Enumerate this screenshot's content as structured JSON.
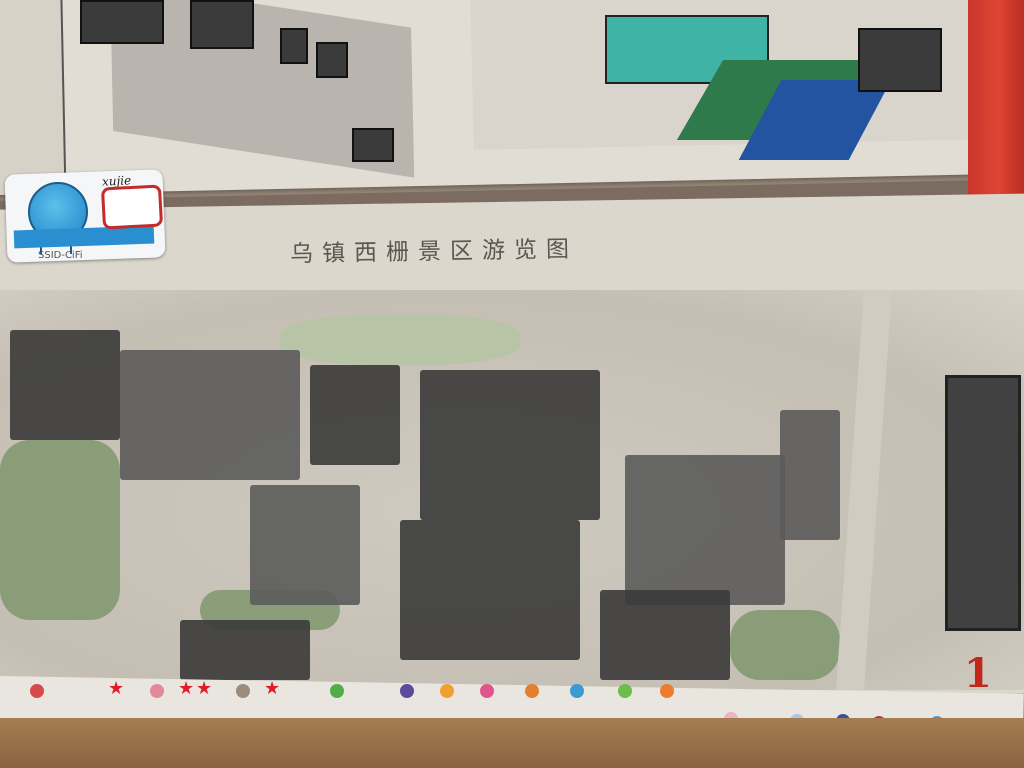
{
  "image": {
    "scene": "Photo of a wall-hung tourist map of Wuzhen West Scenic Area",
    "map_title": "乌镇西栅景区游览图",
    "page_number": "1",
    "sticker": {
      "username": "xujie",
      "brand": "SSID-CiFi"
    },
    "colors": {
      "red_scroll": "#d23a2c",
      "pond": "#3fb3a6",
      "canal_blue": "#2254a2",
      "page_number_red": "#c0281c",
      "sticker_frame_red": "#c42c2c"
    }
  }
}
